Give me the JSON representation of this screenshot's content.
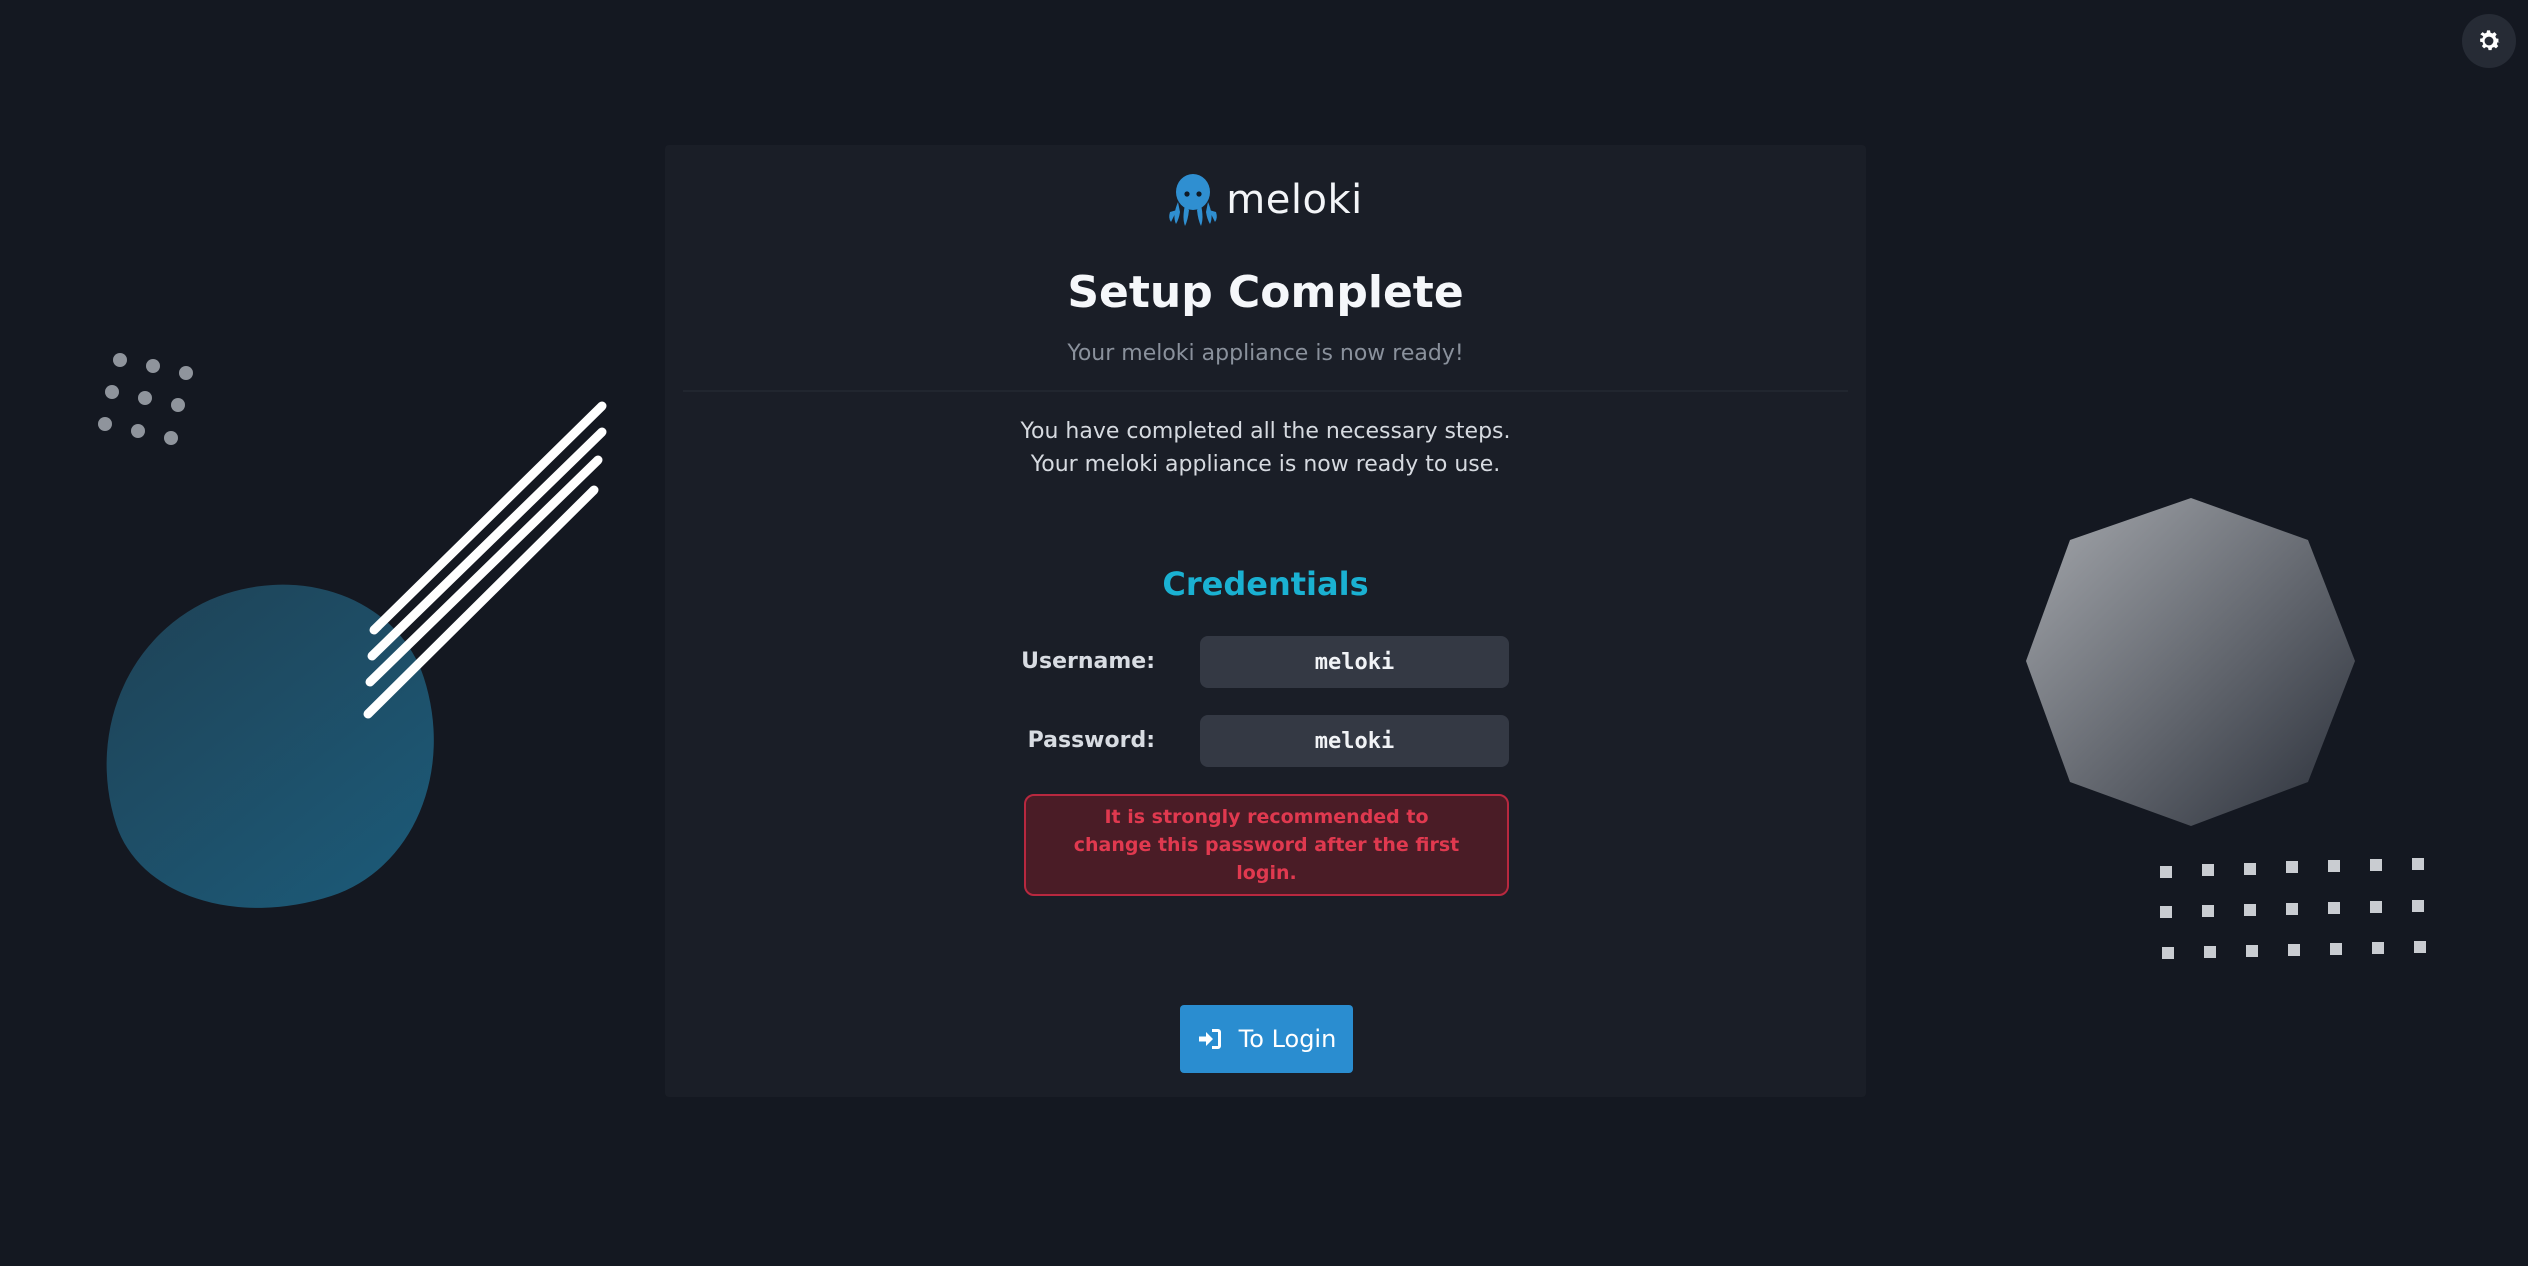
{
  "brand": {
    "name": "meloki",
    "accent_color": "#1ab1d2",
    "button_color": "#2a8dd0"
  },
  "icons": {
    "theme_toggle": "gear-icon",
    "logo": "octopus-icon",
    "login": "sign-in-icon"
  },
  "setup": {
    "title": "Setup Complete",
    "subtitle": "Your meloki appliance is now ready!",
    "message_line1": "You have completed all the necessary steps.",
    "message_line2": "Your meloki appliance is now ready to use."
  },
  "credentials": {
    "heading": "Credentials",
    "username_label": "Username:",
    "username_value": "meloki",
    "password_label": "Password:",
    "password_value": "meloki"
  },
  "alert": {
    "text": "It is strongly recommended to change this password after the first login.",
    "color": "#e0394f"
  },
  "actions": {
    "login_label": "To Login"
  }
}
